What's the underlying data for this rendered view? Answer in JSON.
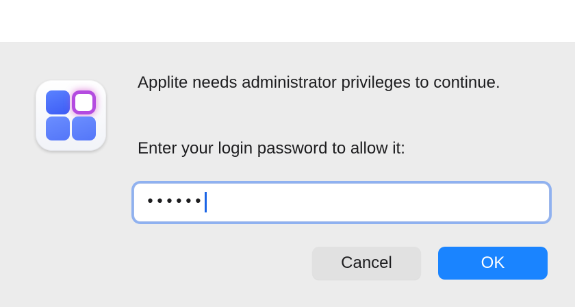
{
  "dialog": {
    "app_name": "Applite",
    "message": "Applite needs administrator privileges to continue.",
    "prompt": "Enter your login password to allow it:",
    "password_field": {
      "value": "••••••"
    },
    "buttons": {
      "cancel_label": "Cancel",
      "ok_label": "OK"
    },
    "icon": "applite-app-icon"
  },
  "colors": {
    "accent": "#1a84ff",
    "focus_ring": "#8fb1f0",
    "tile_blue": "#4a6cf7",
    "tile_highlight": "#b44be0"
  }
}
